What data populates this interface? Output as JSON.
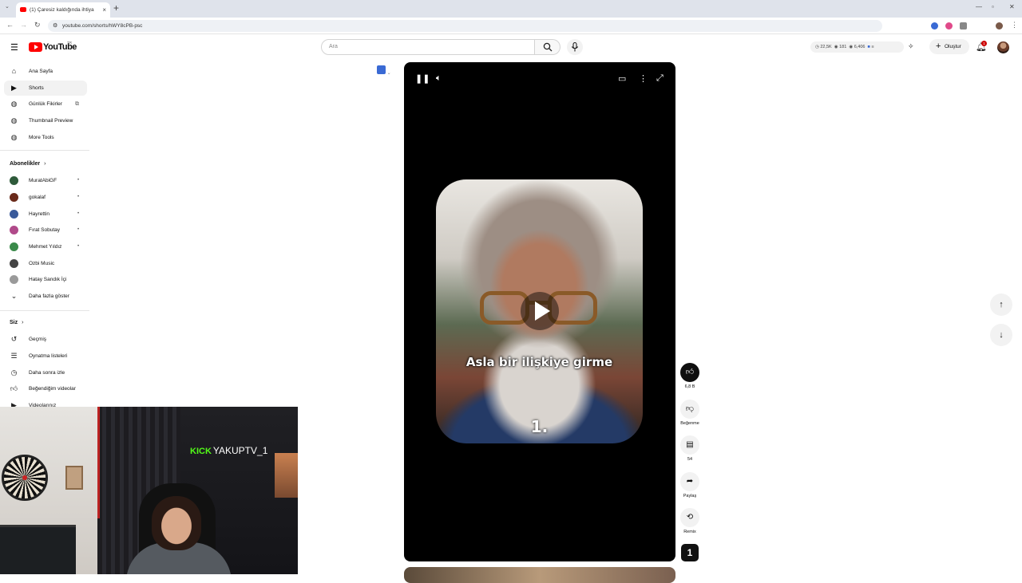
{
  "browser": {
    "tab_title": "(1) Çaresiz kaldığında ihtiya",
    "url": "youtube.com/shorts/hWY8cPB-psc",
    "new_tab_label": "+",
    "close_tab_label": "×"
  },
  "header": {
    "logo_text": "YouTube",
    "logo_region": "TR",
    "search_placeholder": "Ara",
    "stats": {
      "views": "22,5K",
      "watchers": "181",
      "other": "6,406"
    },
    "create_label": "Oluştur",
    "notifications_count": "1"
  },
  "sidebar": {
    "main_items": [
      {
        "label": "Ana Sayfa",
        "icon": "home-icon"
      },
      {
        "label": "Shorts",
        "icon": "shorts-icon",
        "active": true
      },
      {
        "label": "Günlük Fikirler",
        "icon": "extension-icon"
      },
      {
        "label": "Thumbnail Preview",
        "icon": "extension-icon"
      },
      {
        "label": "More Tools",
        "icon": "extension-icon"
      }
    ],
    "subscriptions_title": "Abonelikler",
    "subscriptions": [
      {
        "label": "MuratAbiGF",
        "color": "#2e5a3a"
      },
      {
        "label": "gokalaf",
        "color": "#6a2a1a"
      },
      {
        "label": "Hayrettin",
        "color": "#3a5a9a"
      },
      {
        "label": "Fırat Sobutay",
        "color": "#b04a8a"
      },
      {
        "label": "Mehmet Yıldız",
        "color": "#3a8a4a"
      },
      {
        "label": "Ozbi Music",
        "color": "#444444"
      },
      {
        "label": "Hatay Sandık İçi",
        "color": "#9a9a9a"
      }
    ],
    "show_more_label": "Daha fazla göster",
    "you_title": "Siz",
    "you_items": [
      {
        "label": "Geçmiş",
        "icon": "history-icon"
      },
      {
        "label": "Oynatma listeleri",
        "icon": "playlist-icon"
      },
      {
        "label": "Daha sonra izle",
        "icon": "clock-icon"
      },
      {
        "label": "Beğendiğim videolar",
        "icon": "like-icon"
      },
      {
        "label": "Videolarınız",
        "icon": "video-icon"
      }
    ]
  },
  "player": {
    "caption": "Asla bir ilişkiye girme",
    "overlay_number": "1."
  },
  "actions": {
    "like_count": "6,8 B",
    "dislike_label": "Beğenme",
    "comments_count": "54",
    "share_label": "Paylaş",
    "remix_label": "Remix",
    "channel_initial": "1"
  },
  "webcam": {
    "kick_brand": "KICK",
    "kick_username": "YAKUPTV_1"
  },
  "colors": {
    "yt_red": "#ff0000",
    "kick_green": "#53fc18",
    "active_bg": "#f2f2f2"
  }
}
